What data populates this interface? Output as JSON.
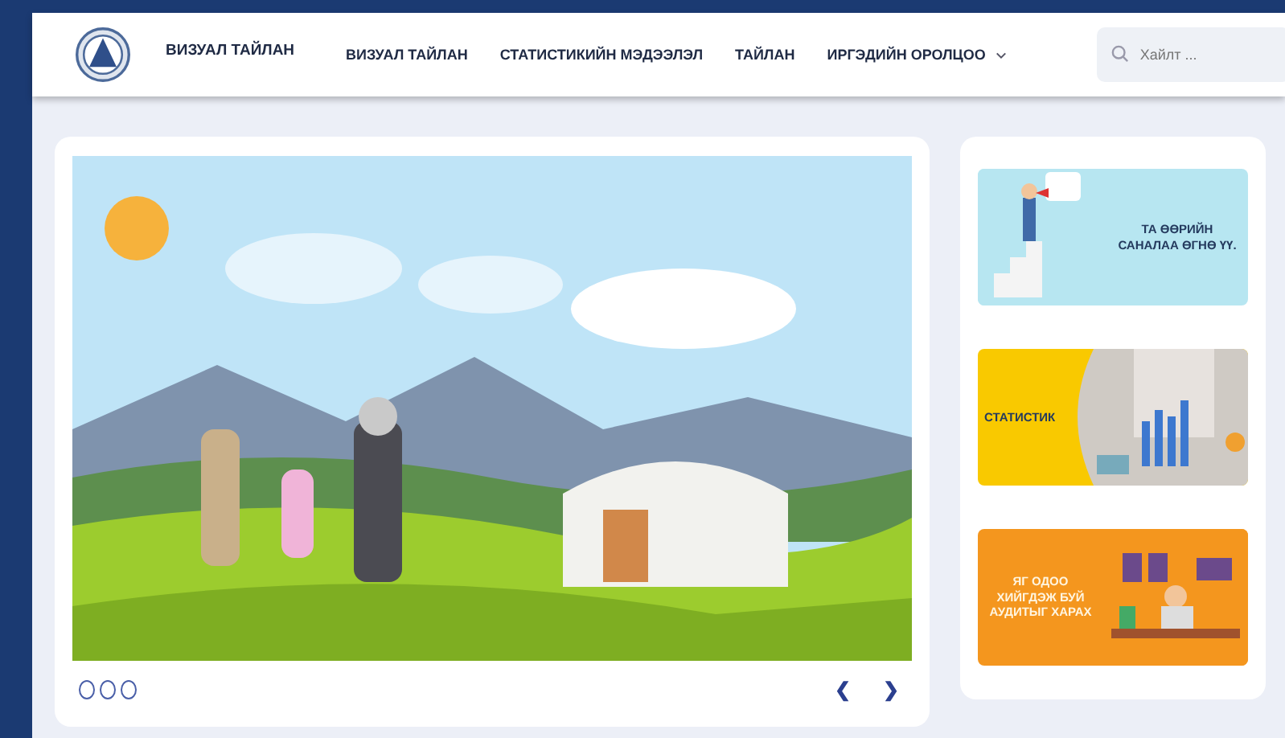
{
  "header": {
    "brand": "ВИЗУАЛ ТАЙЛАН",
    "nav": [
      {
        "label": "ВИЗУАЛ ТАЙЛАН",
        "dropdown": false
      },
      {
        "label": "СТАТИСТИКИЙН МЭДЭЭЛЭЛ",
        "dropdown": false
      },
      {
        "label": "ТАЙЛАН",
        "dropdown": false
      },
      {
        "label": "ИРГЭДИЙН ОРОЛЦОО",
        "dropdown": true
      }
    ],
    "search": {
      "placeholder": "Хайлт ..."
    }
  },
  "slider": {
    "dots": [
      {
        "selected": false
      },
      {
        "selected": false
      },
      {
        "selected": false
      }
    ],
    "prev": "❮",
    "next": "❯"
  },
  "banners": [
    {
      "kind": "feedback",
      "text": "ТА ӨӨРИЙН САНАЛАА ӨГНӨ ҮҮ.",
      "color": "#b7e6f1"
    },
    {
      "kind": "statistics",
      "text": "СТАТИСТИК",
      "color": "#f9c900"
    },
    {
      "kind": "audit",
      "text": "ЯГ ОДОО ХИЙГДЭЖ БУЙ АУДИТЫГ ХАРАХ",
      "color": "#f4961e"
    }
  ]
}
